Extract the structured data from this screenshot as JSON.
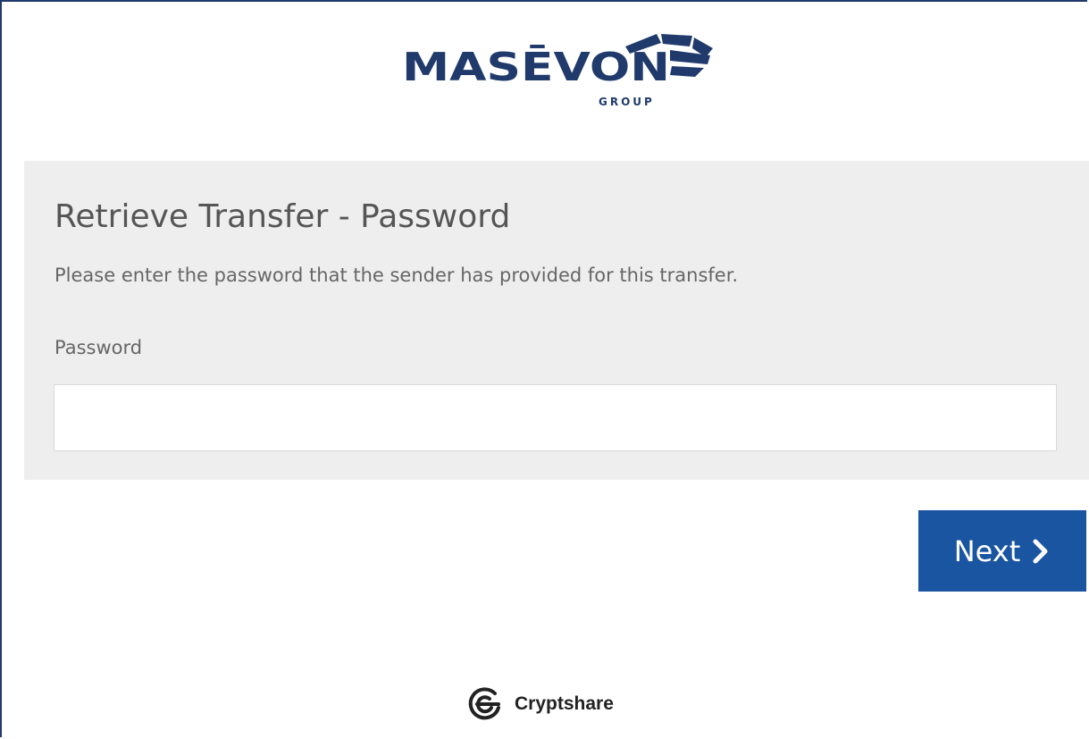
{
  "brand": {
    "name": "MASĒVON",
    "sub": "GROUP",
    "color": "#1f3a6b"
  },
  "panel": {
    "title": "Retrieve Transfer - Password",
    "description": "Please enter the password that the sender has provided for this transfer.",
    "password_label": "Password",
    "password_value": ""
  },
  "actions": {
    "next_label": "Next",
    "next_color": "#1a55a2"
  },
  "footer": {
    "powered_by": "Cryptshare",
    "icon": "cryptshare-logo-icon"
  }
}
